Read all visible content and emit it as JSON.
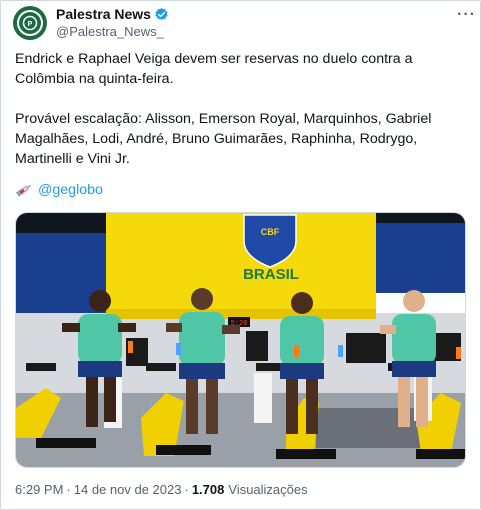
{
  "post": {
    "display_name": "Palestra News",
    "handle": "@Palestra_News_",
    "more_label": "···",
    "text_line_1": "Endrick e Raphael Veiga devem ser reservas no duelo contra a Colômbia na quinta-feira.",
    "text_line_2": "Provável escalação: Alisson, Emerson Royal, Marquinhos, Gabriel Magalhães, Lodi, André, Bruno Guimarães, Raphinha, Rodrygo, Martinelli e Vini Jr.",
    "source_link": "@geglobo",
    "time": "6:29 PM",
    "date": "14 de nov de 2023",
    "dot": "·",
    "views_count": "1.708",
    "views_label": "Visualizações"
  },
  "media": {
    "wall_text": "BRASIL",
    "crest_text": "CBF",
    "timer_text": "5:20"
  },
  "colors": {
    "accent": "#1d9bf0",
    "wall_yellow": "#f5d90a",
    "shirt_green": "#4fc7a7",
    "avatar_green": "#1e6b43"
  }
}
